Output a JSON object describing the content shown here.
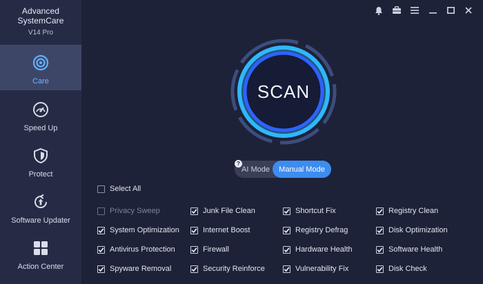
{
  "app": {
    "title": "Advanced SystemCare",
    "edition": "V14 Pro"
  },
  "sidebar": {
    "items": [
      {
        "label": "Care",
        "icon": "care-icon",
        "active": true
      },
      {
        "label": "Speed Up",
        "icon": "speedometer-icon",
        "active": false
      },
      {
        "label": "Protect",
        "icon": "shield-icon",
        "active": false
      },
      {
        "label": "Software Updater",
        "icon": "update-arrow-icon",
        "active": false
      },
      {
        "label": "Action Center",
        "icon": "grid-icon",
        "active": false
      }
    ]
  },
  "topbar": {
    "icons": [
      "bell-icon",
      "toolbox-icon",
      "menu-icon",
      "minimize-icon",
      "maximize-icon",
      "close-icon"
    ]
  },
  "scan": {
    "label": "SCAN"
  },
  "mode": {
    "help": "?",
    "ai_label": "AI Mode",
    "manual_label": "Manual Mode",
    "selected": "Manual Mode"
  },
  "select_all": {
    "label": "Select All",
    "checked": false
  },
  "options": [
    {
      "label": "Privacy Sweep",
      "checked": false
    },
    {
      "label": "Junk File Clean",
      "checked": true
    },
    {
      "label": "Shortcut Fix",
      "checked": true
    },
    {
      "label": "Registry Clean",
      "checked": true
    },
    {
      "label": "System Optimization",
      "checked": true
    },
    {
      "label": "Internet Boost",
      "checked": true
    },
    {
      "label": "Registry Defrag",
      "checked": true
    },
    {
      "label": "Disk Optimization",
      "checked": true
    },
    {
      "label": "Antivirus Protection",
      "checked": true
    },
    {
      "label": "Firewall",
      "checked": true
    },
    {
      "label": "Hardware Health",
      "checked": true
    },
    {
      "label": "Software Health",
      "checked": true
    },
    {
      "label": "Spyware Removal",
      "checked": true
    },
    {
      "label": "Security Reinforce",
      "checked": true
    },
    {
      "label": "Vulnerability Fix",
      "checked": true
    },
    {
      "label": "Disk Check",
      "checked": true
    }
  ],
  "colors": {
    "accent": "#3d8cf0",
    "ring": "#2fb7ff",
    "sidebar": "#262b45",
    "background": "#1d2238"
  }
}
